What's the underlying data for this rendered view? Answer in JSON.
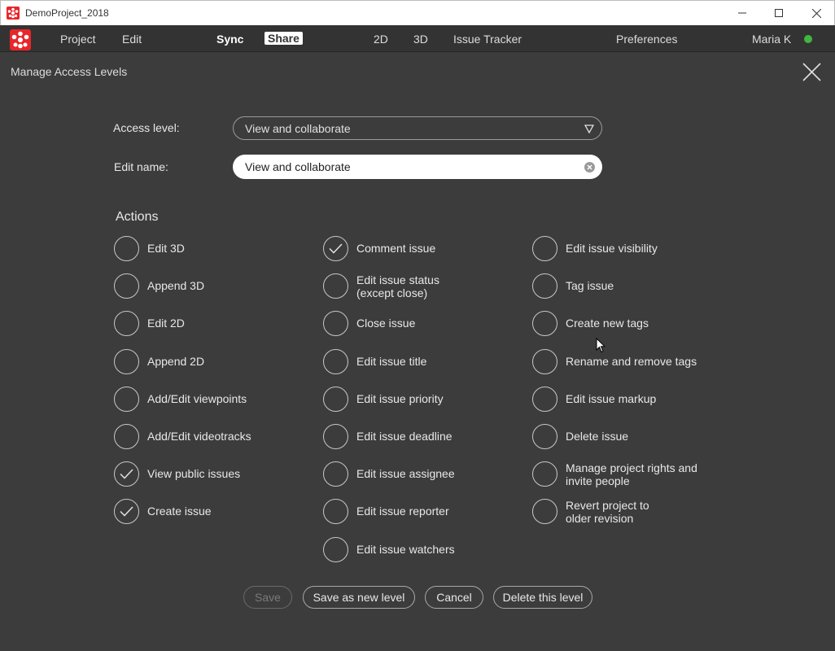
{
  "window": {
    "title": "DemoProject_2018"
  },
  "menu": {
    "project": "Project",
    "edit": "Edit",
    "sync": "Sync",
    "share": "Share",
    "view_2d": "2D",
    "view_3d": "3D",
    "issue_tracker": "Issue Tracker",
    "preferences": "Preferences",
    "user": "Maria K"
  },
  "dialog": {
    "title": "Manage Access Levels",
    "access_level_label": "Access level:",
    "access_level_value": "View and collaborate",
    "edit_name_label": "Edit name:",
    "edit_name_value": "View and collaborate",
    "actions_heading": "Actions"
  },
  "actions": {
    "col1": [
      {
        "label": "Edit 3D",
        "checked": false
      },
      {
        "label": "Append 3D",
        "checked": false
      },
      {
        "label": "Edit 2D",
        "checked": false
      },
      {
        "label": "Append 2D",
        "checked": false
      },
      {
        "label": "Add/Edit viewpoints",
        "checked": false
      },
      {
        "label": "Add/Edit videotracks",
        "checked": false
      },
      {
        "label": "View public issues",
        "checked": true
      },
      {
        "label": "Create issue",
        "checked": true
      }
    ],
    "col2": [
      {
        "label": "Comment issue",
        "checked": true
      },
      {
        "label": "Edit issue status\n(except close)",
        "checked": false
      },
      {
        "label": "Close issue",
        "checked": false
      },
      {
        "label": "Edit issue title",
        "checked": false
      },
      {
        "label": "Edit issue priority",
        "checked": false
      },
      {
        "label": "Edit issue deadline",
        "checked": false
      },
      {
        "label": "Edit issue assignee",
        "checked": false
      },
      {
        "label": "Edit issue reporter",
        "checked": false
      },
      {
        "label": "Edit issue watchers",
        "checked": false
      }
    ],
    "col3": [
      {
        "label": "Edit issue visibility",
        "checked": false
      },
      {
        "label": "Tag issue",
        "checked": false
      },
      {
        "label": "Create new tags",
        "checked": false
      },
      {
        "label": "Rename and remove tags",
        "checked": false
      },
      {
        "label": "Edit issue markup",
        "checked": false
      },
      {
        "label": "Delete issue",
        "checked": false
      },
      {
        "label": "Manage project rights and\ninvite people",
        "checked": false
      },
      {
        "label": "Revert project to\nolder revision",
        "checked": false
      }
    ]
  },
  "buttons": {
    "save": "Save",
    "save_as_new": "Save as new level",
    "cancel": "Cancel",
    "delete": "Delete this level"
  },
  "colors": {
    "background": "#3c3c3c",
    "brand": "#e8262a",
    "online": "#3fb73f"
  }
}
